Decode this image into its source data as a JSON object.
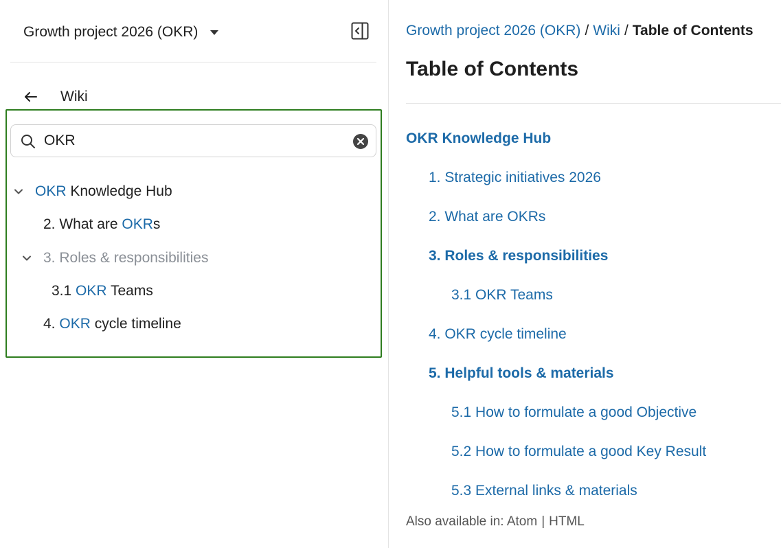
{
  "sidebar": {
    "project_name": "Growth project 2026 (OKR)",
    "back_label": "Wiki",
    "search": {
      "value": "OKR",
      "placeholder": ""
    },
    "tree": [
      {
        "parts": [
          "",
          "OKR",
          " Knowledge Hub"
        ]
      },
      {
        "parts": [
          "2. What are ",
          "OKR",
          "s"
        ]
      },
      {
        "label": "3. Roles & responsibilities"
      },
      {
        "parts": [
          "3.1 ",
          "OKR",
          " Teams"
        ]
      },
      {
        "parts": [
          "4. ",
          "OKR",
          " cycle timeline"
        ]
      }
    ]
  },
  "main": {
    "breadcrumb": {
      "project": "Growth project 2026 (OKR)",
      "sep1": "/",
      "wiki": "Wiki",
      "sep2": "/",
      "current": "Table of Contents"
    },
    "title": "Table of Contents",
    "toc": [
      "OKR Knowledge Hub",
      "1. Strategic initiatives 2026",
      "2. What are OKRs",
      "3. Roles & responsibilities",
      "3.1 OKR Teams",
      "4. OKR cycle timeline",
      "5. Helpful tools & materials",
      "5.1 How to formulate a good Objective",
      "5.2 How to formulate a good Key Result",
      "5.3 External links & materials"
    ],
    "footer": {
      "prefix": "Also available in: ",
      "atom": "Atom",
      "sep": "|",
      "html": "HTML"
    }
  },
  "colors": {
    "link": "#1c6aa8",
    "highlight_border": "#2e7d1e",
    "muted_text": "#8a8f96"
  },
  "icons": [
    "chevron-down-icon",
    "sidebar-collapse-icon",
    "arrow-left-icon",
    "search-icon",
    "clear-icon"
  ]
}
